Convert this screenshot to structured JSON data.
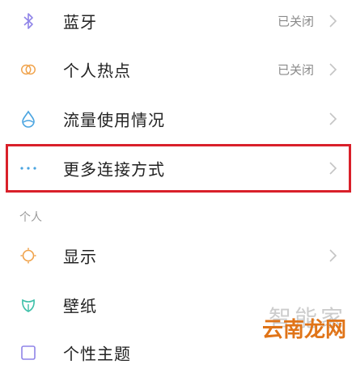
{
  "settings": {
    "items": [
      {
        "label": "蓝牙",
        "status": "已关闭",
        "icon": "bluetooth-icon"
      },
      {
        "label": "个人热点",
        "status": "已关闭",
        "icon": "hotspot-icon"
      },
      {
        "label": "流量使用情况",
        "status": "",
        "icon": "data-usage-icon"
      },
      {
        "label": "更多连接方式",
        "status": "",
        "icon": "more-dots-icon"
      }
    ],
    "section_personal": "个人",
    "personal_items": [
      {
        "label": "显示",
        "icon": "display-icon"
      },
      {
        "label": "壁纸",
        "icon": "wallpaper-icon"
      },
      {
        "label": "个性主题",
        "icon": "theme-icon"
      }
    ]
  },
  "watermark": {
    "top": "智能家",
    "bottom": "云南龙网"
  },
  "colors": {
    "highlight": "#d9202a",
    "icon_purple": "#8f84e8",
    "icon_orange": "#f0a24a",
    "icon_blue": "#4aa4e0",
    "icon_teal": "#3bbfa8"
  }
}
